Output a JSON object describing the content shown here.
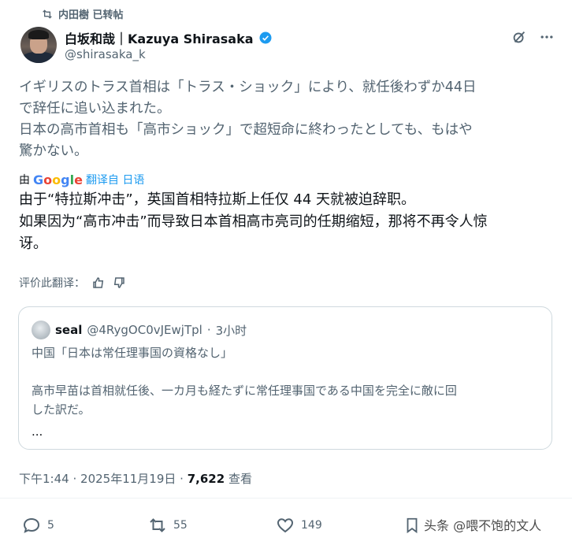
{
  "repost": {
    "label": "内田樹 已转帖"
  },
  "author": {
    "name": "白坂和哉｜Kazuya Shirasaka",
    "handle": "@shirasaka_k"
  },
  "post": {
    "text_ja": [
      "イギリスのトラス首相は「トラス・ショック」により、就任後わずか44日",
      "で辞任に追い込まれた。",
      "日本の高市首相も「高市ショック」で超短命に終わったとしても、もはや",
      "驚かない。"
    ],
    "translation": {
      "prefix": "由",
      "service": "Google",
      "label": "翻译自 日语"
    },
    "text_zh": [
      "由于“特拉斯冲击”，英国首相特拉斯上任仅 44 天就被迫辞职。",
      "如果因为“高市冲击”而导致日本首相高市亮司的任期缩短，那将不再令人惊",
      "讶。"
    ],
    "rate_label": "评价此翻译："
  },
  "quote": {
    "name": "seal",
    "handle": "@4RygOC0vJEwjTpl",
    "separator": "·",
    "time": "3小时",
    "line1": "中国「日本は常任理事国の資格なし」",
    "line2": "高市早苗は首相就任後、一カ月も経たずに常任理事国である中国を完全に敵に回",
    "line3": "した訳だ。",
    "more": "..."
  },
  "meta": {
    "time": "下午1:44",
    "separator": "·",
    "date": "2025年11月19日",
    "views": "7,622",
    "views_label": "查看"
  },
  "actions": {
    "replies": "5",
    "reposts": "55",
    "likes": "149"
  },
  "watermark": "头条 @喂不饱的文人",
  "colors": {
    "text": "#0f1419",
    "muted": "#536471",
    "verified": "#1d9bf0",
    "border": "#cfd9de"
  },
  "icons": [
    "repost-icon",
    "verified-badge-icon",
    "grok-icon",
    "more-icon",
    "thumbs-up-icon",
    "thumbs-down-icon",
    "reply-icon",
    "like-icon",
    "bookmark-icon"
  ]
}
